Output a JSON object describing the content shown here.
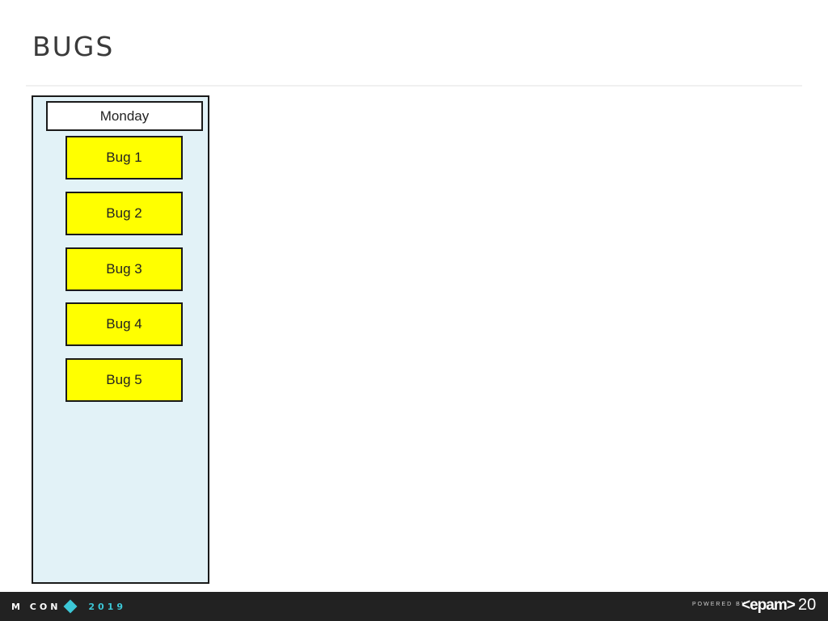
{
  "slide": {
    "title": "BUGS",
    "page_number": "20"
  },
  "board": {
    "column_header": "Monday",
    "cards": [
      "Bug 1",
      "Bug 2",
      "Bug 3",
      "Bug 4",
      "Bug 5"
    ],
    "card_color": "#ffff00",
    "column_color": "#e2f2f7"
  },
  "footer": {
    "conference_logo_text": "MITCON 2019",
    "conference_name": "M  CON",
    "conference_year": "2019",
    "powered_by": "POWERED BY",
    "sponsor": "<epam>",
    "accent_color": "#3cc7d6"
  }
}
